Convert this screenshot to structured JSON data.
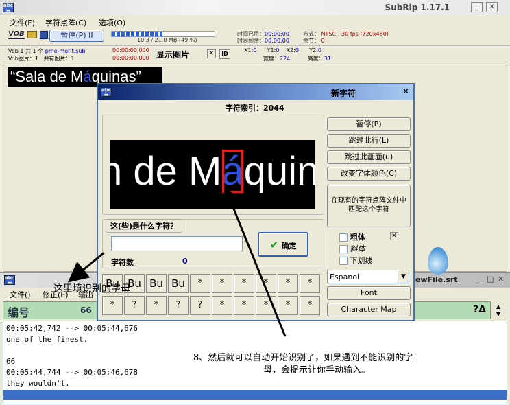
{
  "main_window": {
    "title": "SubRip 1.17.1",
    "menu": [
      "文件(F)",
      "字符点阵(C)",
      "选项(O)"
    ],
    "pause_button": "暂停(P) II",
    "progress_text": "10.3 / 21.0 MB (49 %)",
    "progress_fraction": 0.49,
    "vob_labels": [
      "VOB",
      "VOB"
    ],
    "time_elapsed_label": "时间已用：",
    "time_elapsed_value": "00:00:00",
    "time_remaining_label": "时间剩余：",
    "time_remaining_value": "00:00:00",
    "mode_label": "方式：",
    "mode_value": "NTSC - 30 fps (720x480)",
    "remainder_label": "余节：",
    "remainder_value": "0",
    "vob_info_1": "Vob 1 共 1 个",
    "vob_filename": "pme-morit.sub",
    "vob_info_2": "Vob图片：1",
    "vob_total": "共有图片：1",
    "timestamp_1": "00:00:00,000",
    "timestamp_2": "00:00:00,000",
    "show_picture_label": "显示图片",
    "close_x": "✕",
    "id_button": "ID",
    "coords": {
      "x1_label": "X1:",
      "x1_value": "0",
      "y1_label": "Y1:",
      "y1_value": "0",
      "x2_label": "X2:",
      "x2_value": "0",
      "y2_label": "Y2:",
      "y2_value": "0",
      "width_label": "宽度：",
      "width_value": "224",
      "height_label": "高度：",
      "height_value": "31"
    },
    "subtitle_image_text_before": "“Sala de M",
    "subtitle_image_highlight": "á",
    "subtitle_image_text_after": "quinas”"
  },
  "dialog": {
    "title": "新字符",
    "char_index_label": "字符索引：2044",
    "preview_text_before": "n de M",
    "preview_highlight": "á",
    "preview_text_after": "quinas",
    "question_label": "这(些)是什么字符？",
    "input_value": "",
    "ok_button": "确定",
    "char_count_label": "字符数",
    "char_count_value": "0",
    "side_buttons": [
      "暂停(P)",
      "跳过此行(L)",
      "跳过此画面(u)",
      "改变字体颜色(C)"
    ],
    "match_button": "在现有的字符点阵文件中匹配这个字符",
    "bold_label": "粗体",
    "italic_label": "斜体",
    "underline_label": "下划线",
    "language_value": "Espanol",
    "font_button": "Font",
    "charmap_button": "Character Map",
    "char_grid_row1": [
      "Bu",
      "Bu",
      "Bu",
      "Bu",
      "*",
      "*",
      "*",
      "*",
      "*",
      "*"
    ],
    "char_grid_row2": [
      "*",
      "?",
      "*",
      "?",
      "?",
      "*",
      "*",
      "*",
      "*",
      "*"
    ]
  },
  "bottom_window": {
    "title": "ewFile.srt",
    "menu": [
      "文件()",
      "修正(E)",
      "输出"
    ],
    "header_label": "编号",
    "header_value": "66",
    "header_right": "?Δ",
    "lines": [
      "00:05:42,742 --> 00:05:44,676",
      "one of the finest.",
      "",
      "66",
      "00:05:44,744 --> 00:05:46,678",
      "they wouldn't."
    ]
  },
  "annotations": {
    "left": "这里填识别的字母",
    "right_line1": "8、然后就可以自动开始识别了，如果遇到不能识别的字",
    "right_line2": "母，会提示让你手动输入。"
  },
  "colors": {
    "titlebar_start": "#0a246a",
    "titlebar_end": "#a6caf0",
    "header_bg": "#b4dcb4",
    "selected_row": "#3a6fc4",
    "highlight_box": "#e02020",
    "highlight_char": "#3050e0"
  }
}
